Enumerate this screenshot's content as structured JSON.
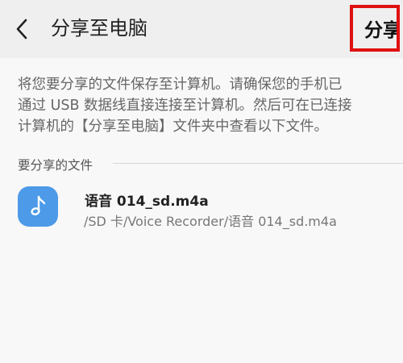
{
  "header": {
    "back_icon": "chevron-left-icon",
    "title": "分享至电脑",
    "share_label": "分享",
    "highlight_color": "#e01010"
  },
  "description": {
    "lines": [
      "将您要分享的文件保存至计算机。请确保您的手机已",
      "通过 USB 数据线直接连接至计算机。然后可在已连接",
      "计算机的【分享至电脑】文件夹中查看以下文件。"
    ]
  },
  "section": {
    "title": "要分享的文件"
  },
  "files": [
    {
      "icon": "music-note-icon",
      "icon_color": "#4c9ae8",
      "name": "语音 014_sd.m4a",
      "path": "/SD 卡/Voice Recorder/语音 014_sd.m4a"
    }
  ]
}
